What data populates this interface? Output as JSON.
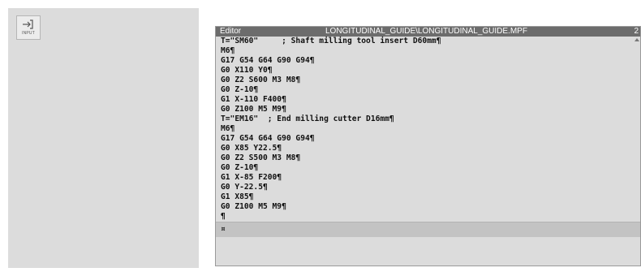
{
  "side_panel": {
    "input_button": {
      "label": "INPUT",
      "icon": "input-arrow-icon"
    }
  },
  "editor": {
    "title_left": "Editor",
    "title_path": "LONGITUDINAL_GUIDE\\LONGITUDINAL_GUIDE.MPF",
    "title_right": "2",
    "lines": [
      "T=\"SM60\"     ; Shaft milling tool insert D60mm¶",
      "M6¶",
      "G17 G54 G64 G90 G94¶",
      "G0 X110 Y0¶",
      "G0 Z2 S600 M3 M8¶",
      "G0 Z-10¶",
      "G1 X-110 F400¶",
      "G0 Z100 M5 M9¶",
      "T=\"EM16\"  ; End milling cutter D16mm¶",
      "M6¶",
      "G17 G54 G64 G90 G94¶",
      "G0 X85 Y22.5¶",
      "G0 Z2 S500 M3 M8¶",
      "G0 Z-10¶",
      "G1 X-85 F200¶",
      "G0 Y-22.5¶",
      "G1 X85¶",
      "G0 Z100 M5 M9¶",
      "¶",
      "¤"
    ]
  }
}
